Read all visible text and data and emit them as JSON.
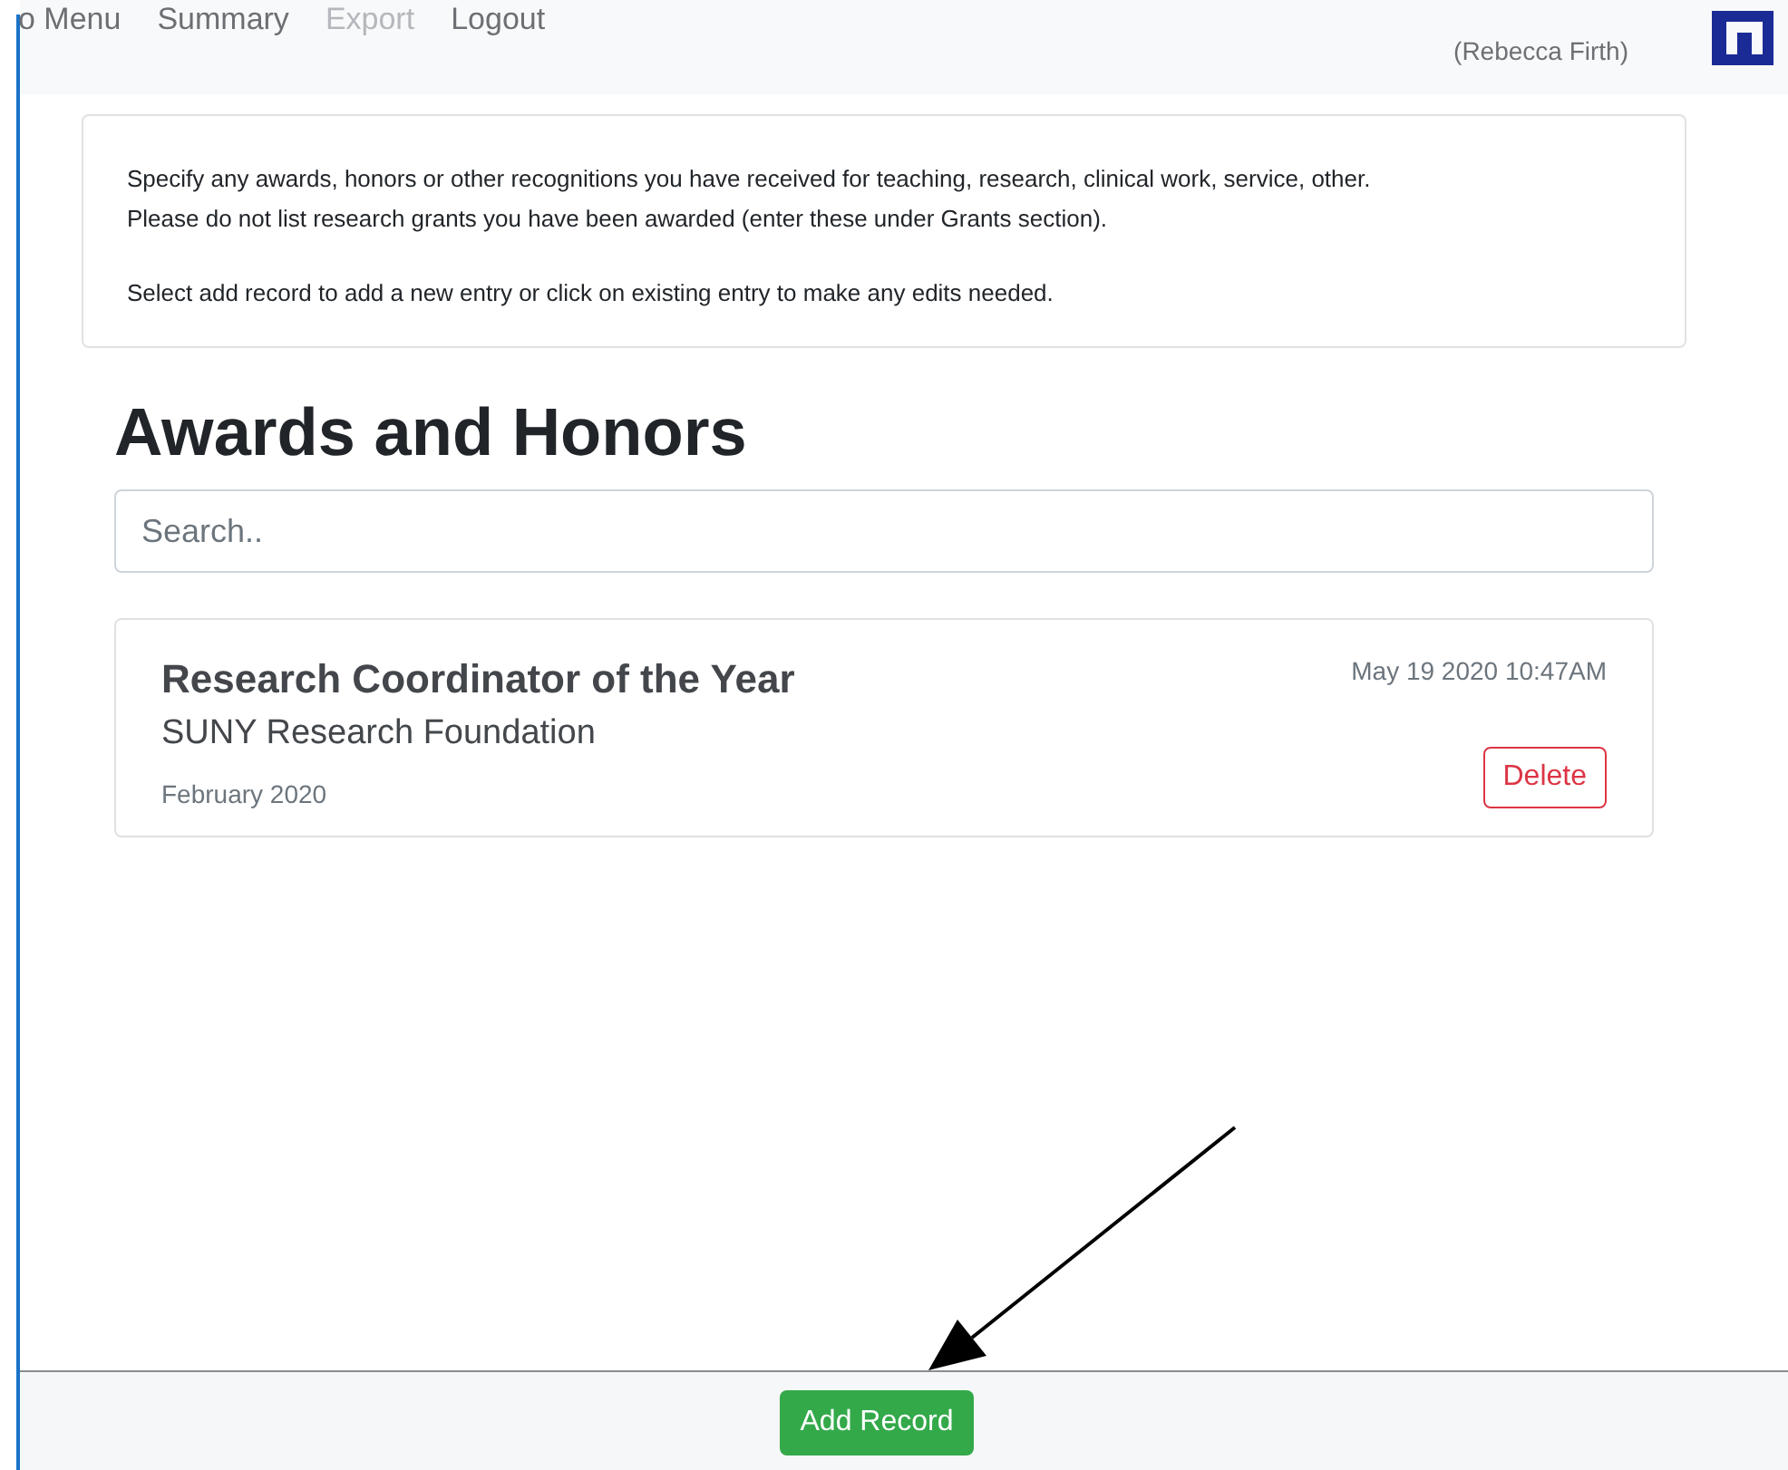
{
  "nav": {
    "items": [
      {
        "label": "o Menu",
        "disabled": false
      },
      {
        "label": "Summary",
        "disabled": false
      },
      {
        "label": "Export",
        "disabled": true
      },
      {
        "label": "Logout",
        "disabled": false
      }
    ],
    "user": "(Rebecca Firth)"
  },
  "info": {
    "paragraphs": [
      [
        "Specify any awards, honors or other recognitions you have received for teaching, research, clinical work, service, other.",
        "Please do not list research grants you have been awarded (enter these under Grants section)."
      ],
      [
        "Select add record to add a new entry or click on existing entry to make any edits needed."
      ]
    ]
  },
  "heading": "Awards and Honors",
  "search": {
    "placeholder": "Search.."
  },
  "records": [
    {
      "title": "Research Coordinator of the Year",
      "organization": "SUNY Research Foundation",
      "date": "February 2020",
      "timestamp": "May 19 2020 10:47AM",
      "action": "Delete"
    }
  ],
  "footer": {
    "button": "Add Record"
  }
}
